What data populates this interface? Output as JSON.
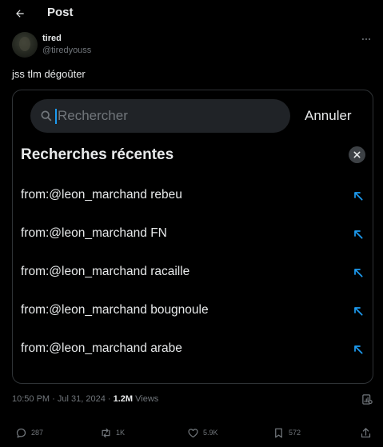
{
  "header": {
    "title": "Post",
    "back_icon": "arrow-left-icon"
  },
  "author": {
    "name": "tired",
    "handle": "@tiredyouss",
    "more_icon": "more-horizontal-icon"
  },
  "tweet": {
    "text": "jss tlm dégoûter"
  },
  "media": {
    "search": {
      "placeholder": "Rechercher",
      "value": "",
      "icon": "search-icon"
    },
    "cancel_label": "Annuler",
    "recent_title": "Recherches récentes",
    "clear_icon": "close-icon",
    "recent_items": [
      {
        "label": "from:@leon_marchand rebeu"
      },
      {
        "label": "from:@leon_marchand FN"
      },
      {
        "label": "from:@leon_marchand racaille"
      },
      {
        "label": "from:@leon_marchand bougnoule"
      },
      {
        "label": "from:@leon_marchand arabe"
      }
    ]
  },
  "meta": {
    "time": "10:50 PM",
    "date": "Jul 31, 2024",
    "views": "1.2M",
    "views_label": "Views"
  },
  "actions": {
    "replies": "287",
    "reposts": "1K",
    "likes": "5.9K",
    "bookmarks": "572"
  },
  "colors": {
    "accent": "#1d9bf0",
    "background": "#000000",
    "muted": "#71767b",
    "text": "#e7e9ea"
  }
}
